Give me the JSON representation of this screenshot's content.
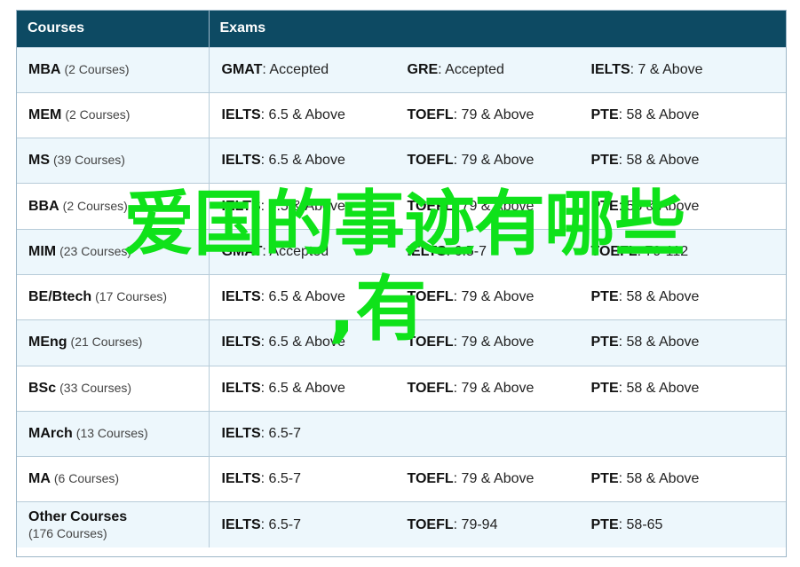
{
  "header": {
    "col_courses": "Courses",
    "col_exams": "Exams"
  },
  "rows": [
    {
      "course": "MBA",
      "count": "(2 Courses)",
      "exams": [
        {
          "name": "GMAT",
          "value": ": Accepted"
        },
        {
          "name": "GRE",
          "value": ": Accepted"
        },
        {
          "name": "IELTS",
          "value": ": 7 & Above"
        }
      ]
    },
    {
      "course": "MEM",
      "count": "(2 Courses)",
      "exams": [
        {
          "name": "IELTS",
          "value": ": 6.5 & Above"
        },
        {
          "name": "TOEFL",
          "value": ": 79 & Above"
        },
        {
          "name": "PTE",
          "value": ": 58 & Above"
        }
      ]
    },
    {
      "course": "MS",
      "count": "(39 Courses)",
      "exams": [
        {
          "name": "IELTS",
          "value": ": 6.5 & Above"
        },
        {
          "name": "TOEFL",
          "value": ": 79 & Above"
        },
        {
          "name": "PTE",
          "value": ": 58 & Above"
        }
      ]
    },
    {
      "course": "BBA",
      "count": "(2 Courses)",
      "exams": [
        {
          "name": "IELTS",
          "value": ": 6.5 & Above"
        },
        {
          "name": "TOEFL",
          "value": ": 79 & Above"
        },
        {
          "name": "PTE",
          "value": ": 58 & Above"
        }
      ]
    },
    {
      "course": "MIM",
      "count": "(23 Courses)",
      "exams": [
        {
          "name": "GMAT",
          "value": ": Accepted"
        },
        {
          "name": "IELTS",
          "value": ": 6.5-7"
        },
        {
          "name": "TOEFL",
          "value": ": 79-112"
        }
      ]
    },
    {
      "course": "BE/Btech",
      "count": "(17 Courses)",
      "exams": [
        {
          "name": "IELTS",
          "value": ": 6.5 & Above"
        },
        {
          "name": "TOEFL",
          "value": ": 79 & Above"
        },
        {
          "name": "PTE",
          "value": ": 58 & Above"
        }
      ]
    },
    {
      "course": "MEng",
      "count": "(21 Courses)",
      "exams": [
        {
          "name": "IELTS",
          "value": ": 6.5 & Above"
        },
        {
          "name": "TOEFL",
          "value": ": 79 & Above"
        },
        {
          "name": "PTE",
          "value": ": 58 & Above"
        }
      ]
    },
    {
      "course": "BSc",
      "count": "(33 Courses)",
      "exams": [
        {
          "name": "IELTS",
          "value": ": 6.5 & Above"
        },
        {
          "name": "TOEFL",
          "value": ": 79 & Above"
        },
        {
          "name": "PTE",
          "value": ": 58 & Above"
        }
      ]
    },
    {
      "course": "MArch",
      "count": "(13 Courses)",
      "exams": [
        {
          "name": "IELTS",
          "value": ": 6.5-7"
        },
        {
          "name": "",
          "value": ""
        },
        {
          "name": "",
          "value": ""
        }
      ]
    },
    {
      "course": "MA",
      "count": "(6 Courses)",
      "exams": [
        {
          "name": "IELTS",
          "value": ": 6.5-7"
        },
        {
          "name": "TOEFL",
          "value": ": 79 & Above"
        },
        {
          "name": "PTE",
          "value": ": 58 & Above"
        }
      ]
    },
    {
      "course": "Other Courses",
      "count": "(176 Courses)",
      "exams": [
        {
          "name": "IELTS",
          "value": ": 6.5-7"
        },
        {
          "name": "TOEFL",
          "value": ": 79-94"
        },
        {
          "name": "PTE",
          "value": ": 58-65"
        }
      ]
    }
  ],
  "overlay": {
    "line1": "爱国的事迹有哪些",
    "line2": ",有"
  },
  "colors": {
    "header_bg": "#0d4a63",
    "overlay_text": "#0fe21a"
  }
}
